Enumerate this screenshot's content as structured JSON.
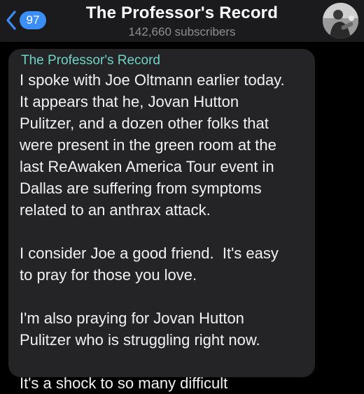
{
  "header": {
    "back_badge": "97",
    "title": "The Professor's Record",
    "subtitle": "142,660 subscribers",
    "avatar_icon": "channel-avatar"
  },
  "message": {
    "sender": "The Professor's Record",
    "paragraphs": [
      "I spoke with Joe Oltmann earlier today.\nIt appears that he, Jovan Hutton\nPulitzer, and a dozen other folks that\nwere present in the green room at the\nlast ReAwaken America Tour event in\nDallas are suffering from symptoms\nrelated to an anthrax attack.",
      "I consider Joe a good friend.  It's easy\nto pray for those you love.",
      "I'm also praying for Jovan Hutton\nPulitzer who is struggling right now.",
      "It's a shock to so many difficult"
    ]
  },
  "colors": {
    "accent_blue": "#3a8ef6",
    "sender_teal": "#6fd3c6",
    "bubble_bg": "#242426",
    "header_bg": "#1b1b1d"
  }
}
